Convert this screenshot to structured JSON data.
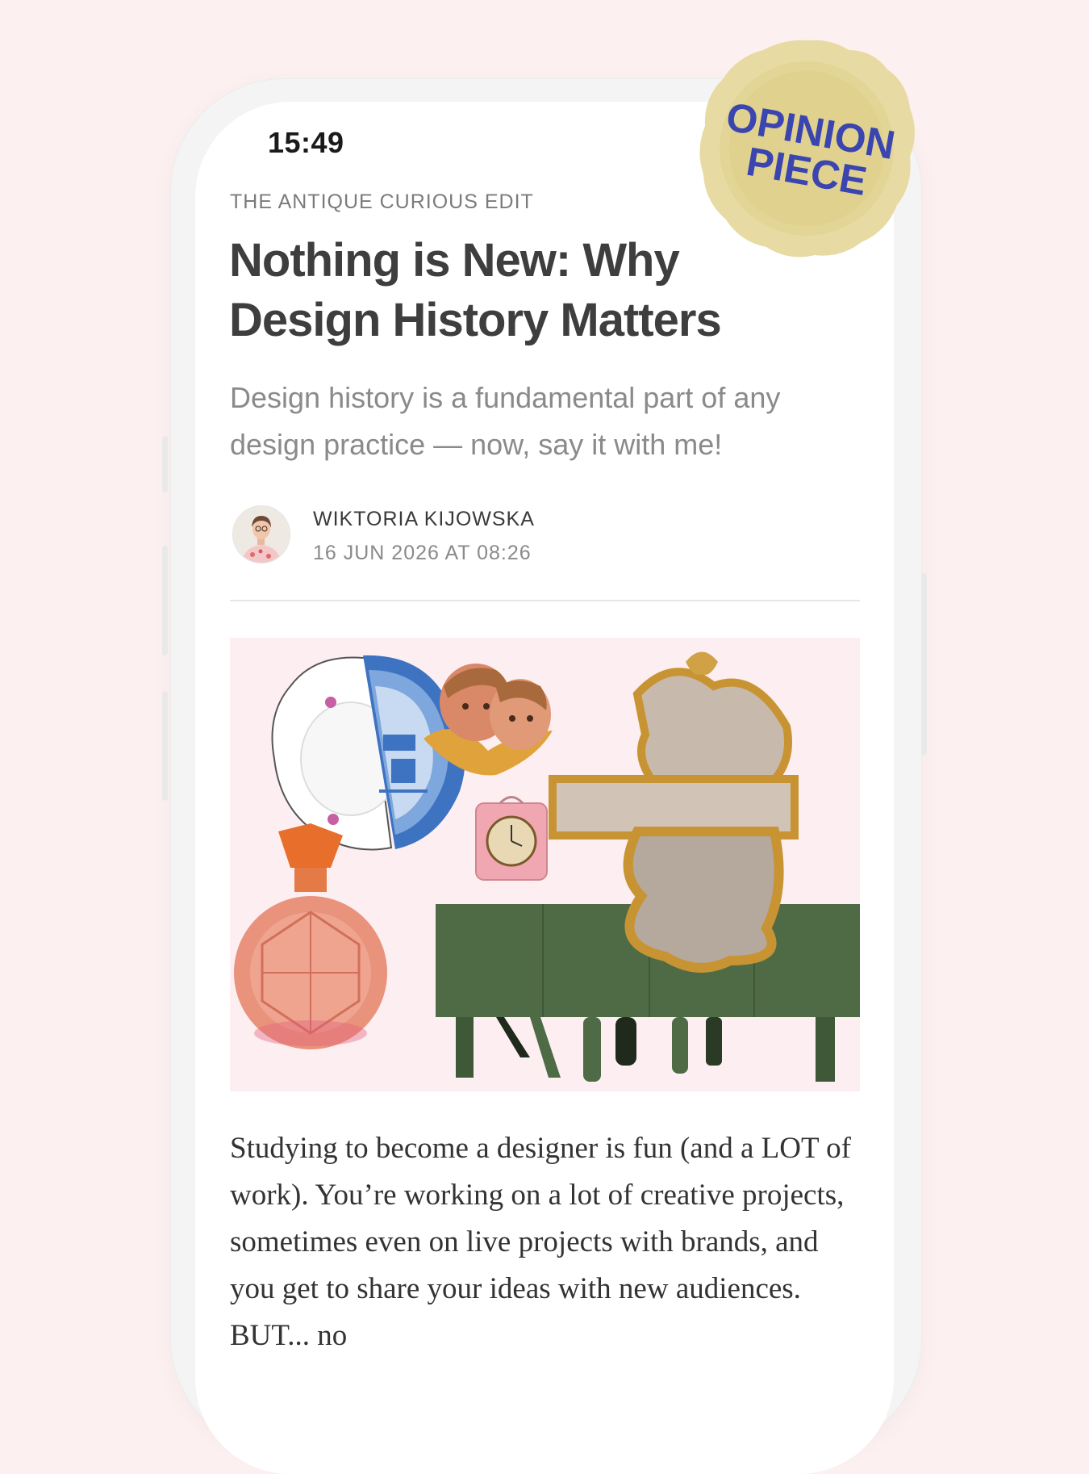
{
  "status_bar": {
    "time": "15:49"
  },
  "article": {
    "kicker": "THE ANTIQUE CURIOUS EDIT",
    "title": "Nothing is New: Why Design History Matters",
    "subtitle": "Design history is a fundamental part of any design practice — now, say it with me!",
    "author": {
      "name": "WIKTORIA KIJOWSKA",
      "date": "16 JUN 2026 AT 08:26"
    },
    "body": "Studying to become a designer is fun (and a LOT of work). You’re working on a lot of creative projects, sometimes even on live projects with brands, and you get to share your ideas with new audiences. BUT... no"
  },
  "seal": {
    "line1": "OPINION",
    "line2": "PIECE",
    "color": "#3b45b0"
  },
  "colors": {
    "background": "#fcf0f1",
    "hero_background": "#fdeff1",
    "sideboard": "#4f6b45",
    "frame_gold": "#c89433"
  }
}
